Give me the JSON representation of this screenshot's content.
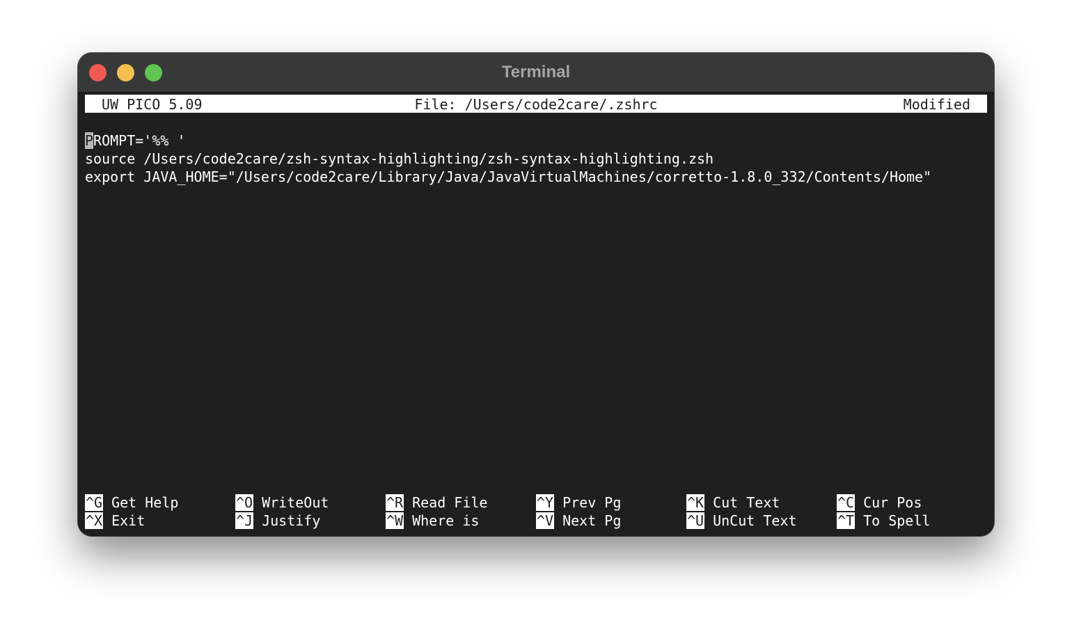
{
  "window": {
    "title": "Terminal"
  },
  "pico": {
    "version": "UW PICO 5.09",
    "file": "File: /Users/code2care/.zshrc",
    "status": "Modified"
  },
  "editor": {
    "cursor_char": "P",
    "line1_rest": "ROMPT='%% '",
    "line2": "source /Users/code2care/zsh-syntax-highlighting/zsh-syntax-highlighting.zsh",
    "line3": "export JAVA_HOME=\"/Users/code2care/Library/Java/JavaVirtualMachines/corretto-1.8.0_332/Contents/Home\""
  },
  "shortcuts": [
    {
      "key": "^G",
      "label": "Get Help"
    },
    {
      "key": "^O",
      "label": "WriteOut"
    },
    {
      "key": "^R",
      "label": "Read File"
    },
    {
      "key": "^Y",
      "label": "Prev Pg"
    },
    {
      "key": "^K",
      "label": "Cut Text"
    },
    {
      "key": "^C",
      "label": "Cur Pos"
    },
    {
      "key": "^X",
      "label": "Exit"
    },
    {
      "key": "^J",
      "label": "Justify"
    },
    {
      "key": "^W",
      "label": "Where is"
    },
    {
      "key": "^V",
      "label": "Next Pg"
    },
    {
      "key": "^U",
      "label": "UnCut Text"
    },
    {
      "key": "^T",
      "label": "To Spell"
    }
  ],
  "colors": {
    "close": "#ee5a52",
    "minimize": "#f4bf4f",
    "maximize": "#5fc553",
    "terminal_bg": "#1f1f1f",
    "text": "#ffffff"
  }
}
